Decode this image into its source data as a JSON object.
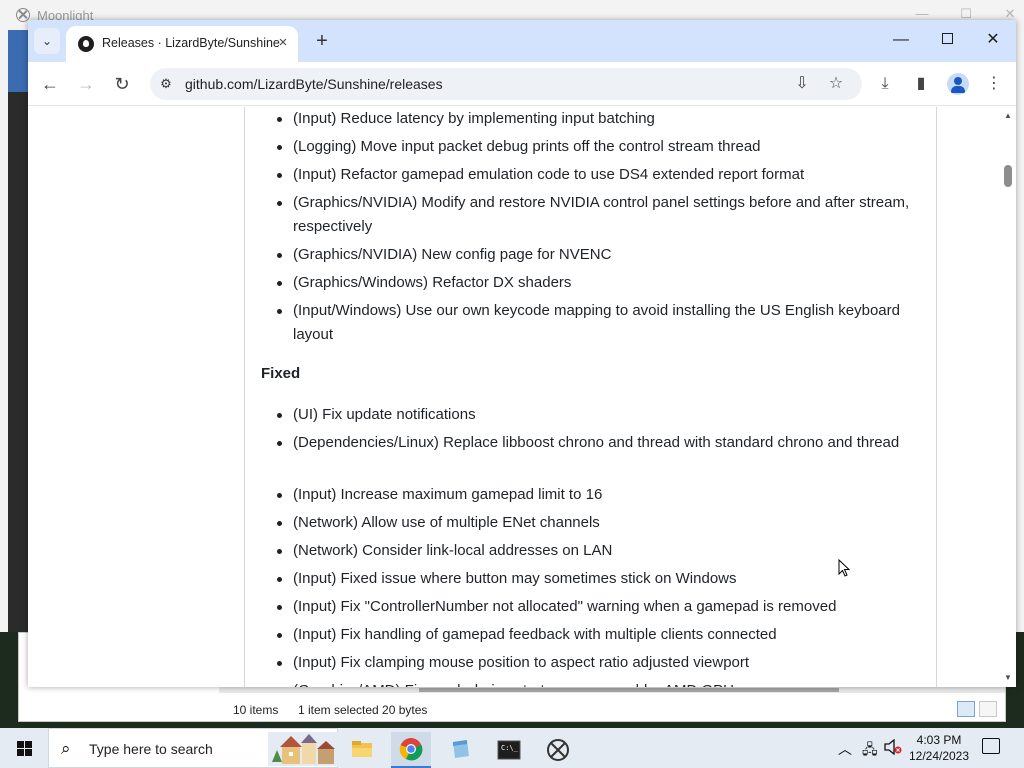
{
  "moonlight": {
    "title": "Moonlight"
  },
  "browser": {
    "tab_title": "Releases · LizardByte/Sunshine",
    "url": "github.com/LizardByte/Sunshine/releases"
  },
  "release_notes": {
    "changed_items": [
      "(Input) Reduce latency by implementing input batching",
      "(Logging) Move input packet debug prints off the control stream thread",
      "(Input) Refactor gamepad emulation code to use DS4 extended report format",
      "(Graphics/NVIDIA) Modify and restore NVIDIA control panel settings before and after stream, respectively",
      "(Graphics/NVIDIA) New config page for NVENC",
      "(Graphics/Windows) Refactor DX shaders",
      "(Input/Windows) Use our own keycode mapping to avoid installing the US English keyboard layout"
    ],
    "fixed_heading": "Fixed",
    "fixed_items": [
      "(UI) Fix update notifications",
      "(Dependencies/Linux) Replace libboost chrono and thread with standard chrono and thread",
      "(Input) Increase maximum gamepad limit to 16",
      "(Network) Allow use of multiple ENet channels",
      "(Network) Consider link-local addresses on LAN",
      "(Input) Fixed issue where button may sometimes stick on Windows",
      "(Input) Fix \"ControllerNumber not allocated\" warning when a gamepad is removed",
      "(Input) Fix handling of gamepad feedback with multiple clients connected",
      "(Input) Fix clamping mouse position to aspect ratio adjusted viewport",
      "(Graphics/AMD) Fix crash during startup on some older AMD GPUs"
    ]
  },
  "explorer": {
    "items": "10 items",
    "selected": "1 item selected  20 bytes"
  },
  "taskbar": {
    "search_placeholder": "Type here to search",
    "time": "4:03 PM",
    "date": "12/24/2023"
  },
  "colors": {
    "tab_strip": "#d3e3fd",
    "taskbar": "#e4ebf2",
    "chrome_icon_red": "#db4437"
  }
}
